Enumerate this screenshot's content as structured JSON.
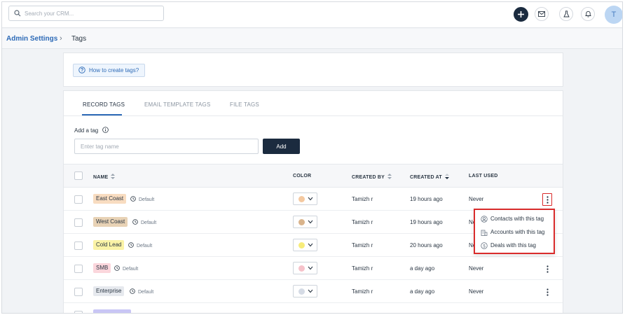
{
  "search": {
    "placeholder": "Search your CRM..."
  },
  "user": {
    "avatar_initial": "T"
  },
  "breadcrumb": {
    "parent": "Admin Settings",
    "current": "Tags"
  },
  "help": {
    "label": "How to create tags?"
  },
  "tabs": [
    {
      "label": "RECORD TAGS",
      "active": true
    },
    {
      "label": "EMAIL TEMPLATE TAGS",
      "active": false
    },
    {
      "label": "FILE TAGS",
      "active": false
    }
  ],
  "add_tag": {
    "label": "Add a tag",
    "placeholder": "Enter tag name",
    "button": "Add"
  },
  "table": {
    "columns": {
      "name": "NAME",
      "color": "COLOR",
      "created_by": "CREATED BY",
      "created_at": "CREATED AT",
      "last_used": "LAST USED"
    },
    "rows": [
      {
        "name": "East Coast",
        "badge": "Default",
        "tag_bg": "#f8dcc0",
        "color": "#f4c9a0",
        "created_by": "Tamizh r",
        "created_at": "19 hours ago",
        "last_used": "Never"
      },
      {
        "name": "West Coast",
        "badge": "Default",
        "tag_bg": "#e8d2b5",
        "color": "#d9b48c",
        "created_by": "Tamizh r",
        "created_at": "19 hours ago",
        "last_used": "Never"
      },
      {
        "name": "Cold Lead",
        "badge": "Default",
        "tag_bg": "#fbf3a6",
        "color": "#f7ec7a",
        "created_by": "Tamizh r",
        "created_at": "20 hours ago",
        "last_used": "Never"
      },
      {
        "name": "SMB",
        "badge": "Default",
        "tag_bg": "#fbd6dc",
        "color": "#f6c2ca",
        "created_by": "Tamizh r",
        "created_at": "a day ago",
        "last_used": "Never"
      },
      {
        "name": "Enterprise",
        "badge": "Default",
        "tag_bg": "#e6e9ee",
        "color": "#d5dbe5",
        "created_by": "Tamizh r",
        "created_at": "a day ago",
        "last_used": "Never"
      }
    ]
  },
  "context_menu": {
    "items": [
      {
        "label": "Contacts with this tag",
        "icon": "person-icon"
      },
      {
        "label": "Accounts with this tag",
        "icon": "building-icon"
      },
      {
        "label": "Deals with this tag",
        "icon": "dollar-icon"
      }
    ]
  },
  "colors": {
    "primary": "#1b2b3f",
    "link": "#2d6ab7",
    "highlight": "#d92b2b"
  }
}
